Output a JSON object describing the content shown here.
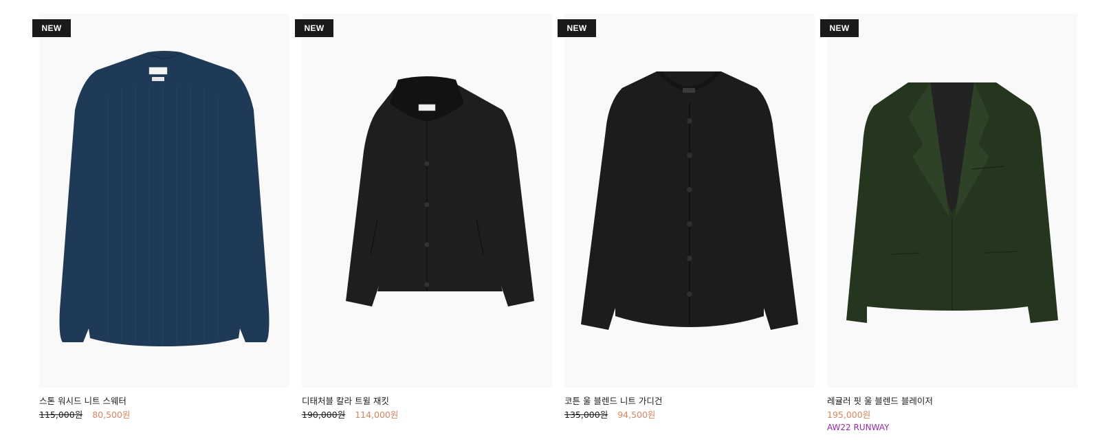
{
  "products": [
    {
      "badge": "NEW",
      "name": "스톤 워시드 니트 스웨터",
      "original_price": "115,000원",
      "sale_price": "80,500원",
      "image_icon": "knit-sweater-navy",
      "garment_color": "#1f3a56"
    },
    {
      "badge": "NEW",
      "name": "디태처블 칼라 트윌 재킷",
      "original_price": "190,000원",
      "sale_price": "114,000원",
      "image_icon": "twill-jacket-black",
      "garment_color": "#1e1e1e"
    },
    {
      "badge": "NEW",
      "name": "코튼 울 블렌드 니트 가디건",
      "original_price": "135,000원",
      "sale_price": "94,500원",
      "image_icon": "knit-cardigan-black",
      "garment_color": "#1c1c1c"
    },
    {
      "badge": "NEW",
      "name": "레귤러 핏 울 블렌드 블레이저",
      "price": "195,000원",
      "tag": "AW22 RUNWAY",
      "image_icon": "wool-blazer-green",
      "garment_color": "#25361f"
    }
  ],
  "colors": {
    "badge_bg": "#1a1a1a",
    "sale_price": "#e0825e",
    "runway_tag": "#9c27b0",
    "image_bg": "#f9f9f9"
  }
}
